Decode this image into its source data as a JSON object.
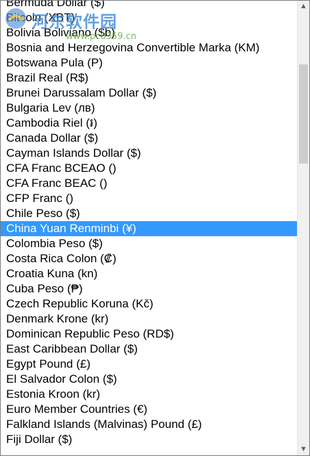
{
  "listbox": {
    "items": [
      "Bermuda Dollar ($)",
      "Bitcoin (XBT)",
      "Bolivia Boliviano ($b)",
      "Bosnia and Herzegovina Convertible Marka (KM)",
      "Botswana Pula (P)",
      "Brazil Real (R$)",
      "Brunei Darussalam Dollar ($)",
      "Bulgaria Lev (лв)",
      "Cambodia Riel (៛)",
      "Canada Dollar ($)",
      "Cayman Islands Dollar ($)",
      "CFA Franc BCEAO ()",
      "CFA Franc BEAC ()",
      "CFP Franc ()",
      "Chile Peso ($)",
      "China Yuan Renminbi (¥)",
      "Colombia Peso ($)",
      "Costa Rica Colon (₡)",
      "Croatia Kuna (kn)",
      "Cuba Peso (₱)",
      "Czech Republic Koruna (Kč)",
      "Denmark Krone (kr)",
      "Dominican Republic Peso (RD$)",
      "East Caribbean Dollar ($)",
      "Egypt Pound (£)",
      "El Salvador Colon ($)",
      "Estonia Kroon (kr)",
      "Euro Member Countries (€)",
      "Falkland Islands (Malvinas) Pound (£)",
      "Fiji Dollar ($)"
    ],
    "selected_index": 15,
    "selection_color": "#3399ff",
    "scroll_fraction": 0.12,
    "visible_fraction": 0.23
  },
  "scrollbar": {
    "up_icon": "▲",
    "down_icon": "▼"
  },
  "watermark": {
    "text": "河东软件园",
    "url": "www.pc0359.cn"
  }
}
